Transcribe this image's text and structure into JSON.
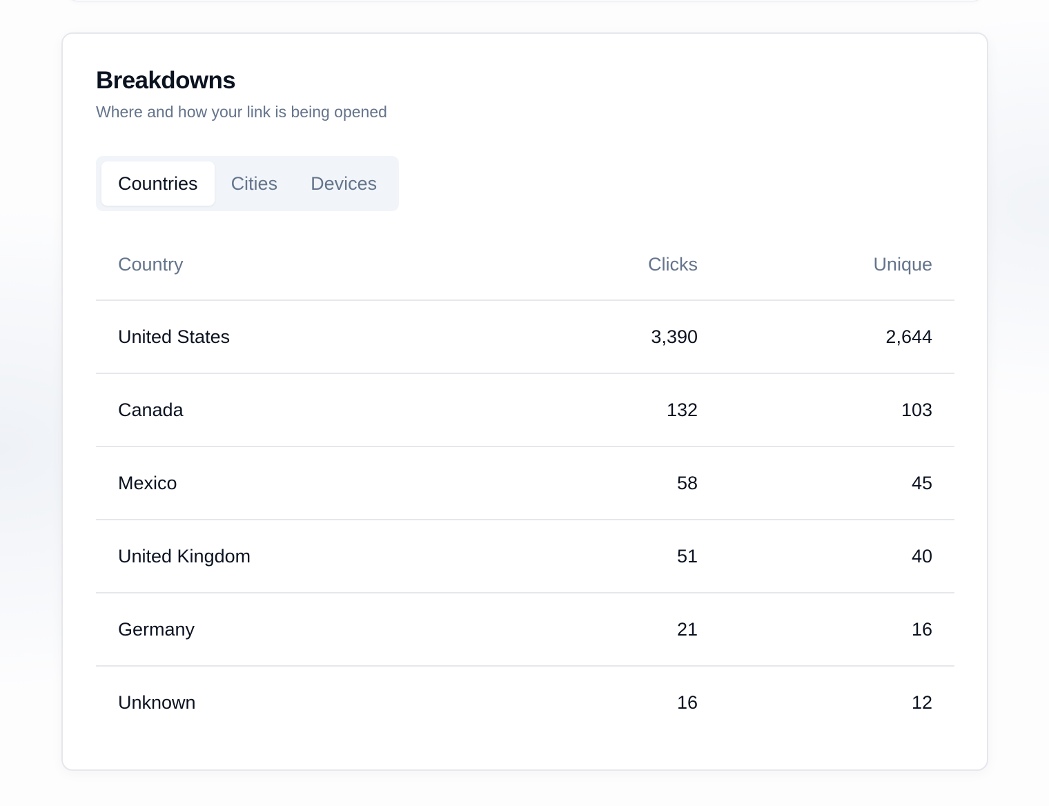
{
  "card": {
    "title": "Breakdowns",
    "subtitle": "Where and how your link is being opened"
  },
  "tabs": [
    {
      "label": "Countries",
      "active": true
    },
    {
      "label": "Cities",
      "active": false
    },
    {
      "label": "Devices",
      "active": false
    }
  ],
  "table": {
    "headers": {
      "name": "Country",
      "clicks": "Clicks",
      "unique": "Unique"
    },
    "rows": [
      {
        "name": "United States",
        "clicks": "3,390",
        "unique": "2,644"
      },
      {
        "name": "Canada",
        "clicks": "132",
        "unique": "103"
      },
      {
        "name": "Mexico",
        "clicks": "58",
        "unique": "45"
      },
      {
        "name": "United Kingdom",
        "clicks": "51",
        "unique": "40"
      },
      {
        "name": "Germany",
        "clicks": "21",
        "unique": "16"
      },
      {
        "name": "Unknown",
        "clicks": "16",
        "unique": "12"
      }
    ]
  },
  "colors": {
    "text_primary": "#0b1220",
    "text_muted": "#64748b",
    "tab_track": "#f1f5f9",
    "border": "#e5e7eb"
  }
}
